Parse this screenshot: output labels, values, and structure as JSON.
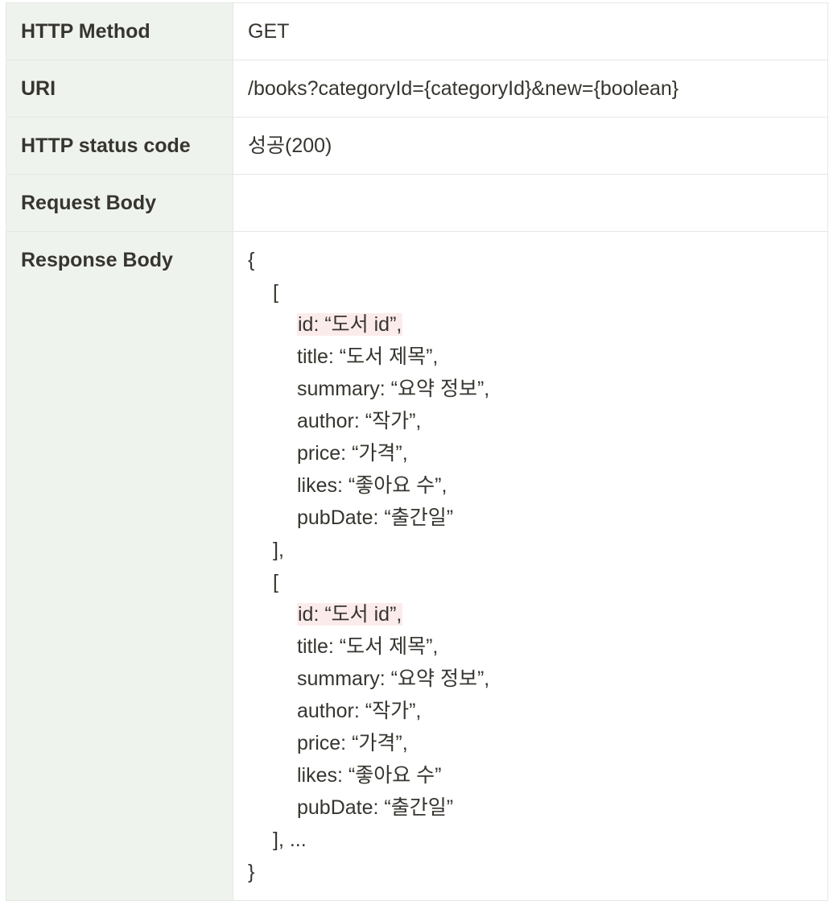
{
  "rows": [
    {
      "key": "HTTP Method",
      "value": "GET"
    },
    {
      "key": "URI",
      "value": "/books?categoryId={categoryId}&new={boolean}"
    },
    {
      "key": "HTTP status code",
      "value": "성공(200)"
    },
    {
      "key": "Request Body",
      "value": ""
    },
    {
      "key": "Response Body"
    }
  ],
  "response_body": {
    "open_brace": "{",
    "item1": {
      "open": "[",
      "id": "id: “도서 id”,",
      "title": "title: “도서 제목”,",
      "summary": "summary: “요약 정보”,",
      "author": "author: “작가”,",
      "price": "price: “가격”,",
      "likes": "likes: “좋아요 수”,",
      "pubDate": "pubDate: “출간일”",
      "close": "],"
    },
    "item2": {
      "open": "[",
      "id": "id: “도서 id”,",
      "title": "title: “도서 제목”,",
      "summary": "summary: “요약 정보”,",
      "author": "author: “작가”,",
      "price": "price: “가격”,",
      "likes": "likes: “좋아요 수”",
      "pubDate": "pubDate: “출간일”",
      "close": "], ..."
    },
    "close_brace": "}"
  },
  "colors": {
    "key_column_bg": "#eff3ee",
    "border": "#e6e6e3",
    "highlight": "#fbeceb",
    "text": "#37352f"
  }
}
